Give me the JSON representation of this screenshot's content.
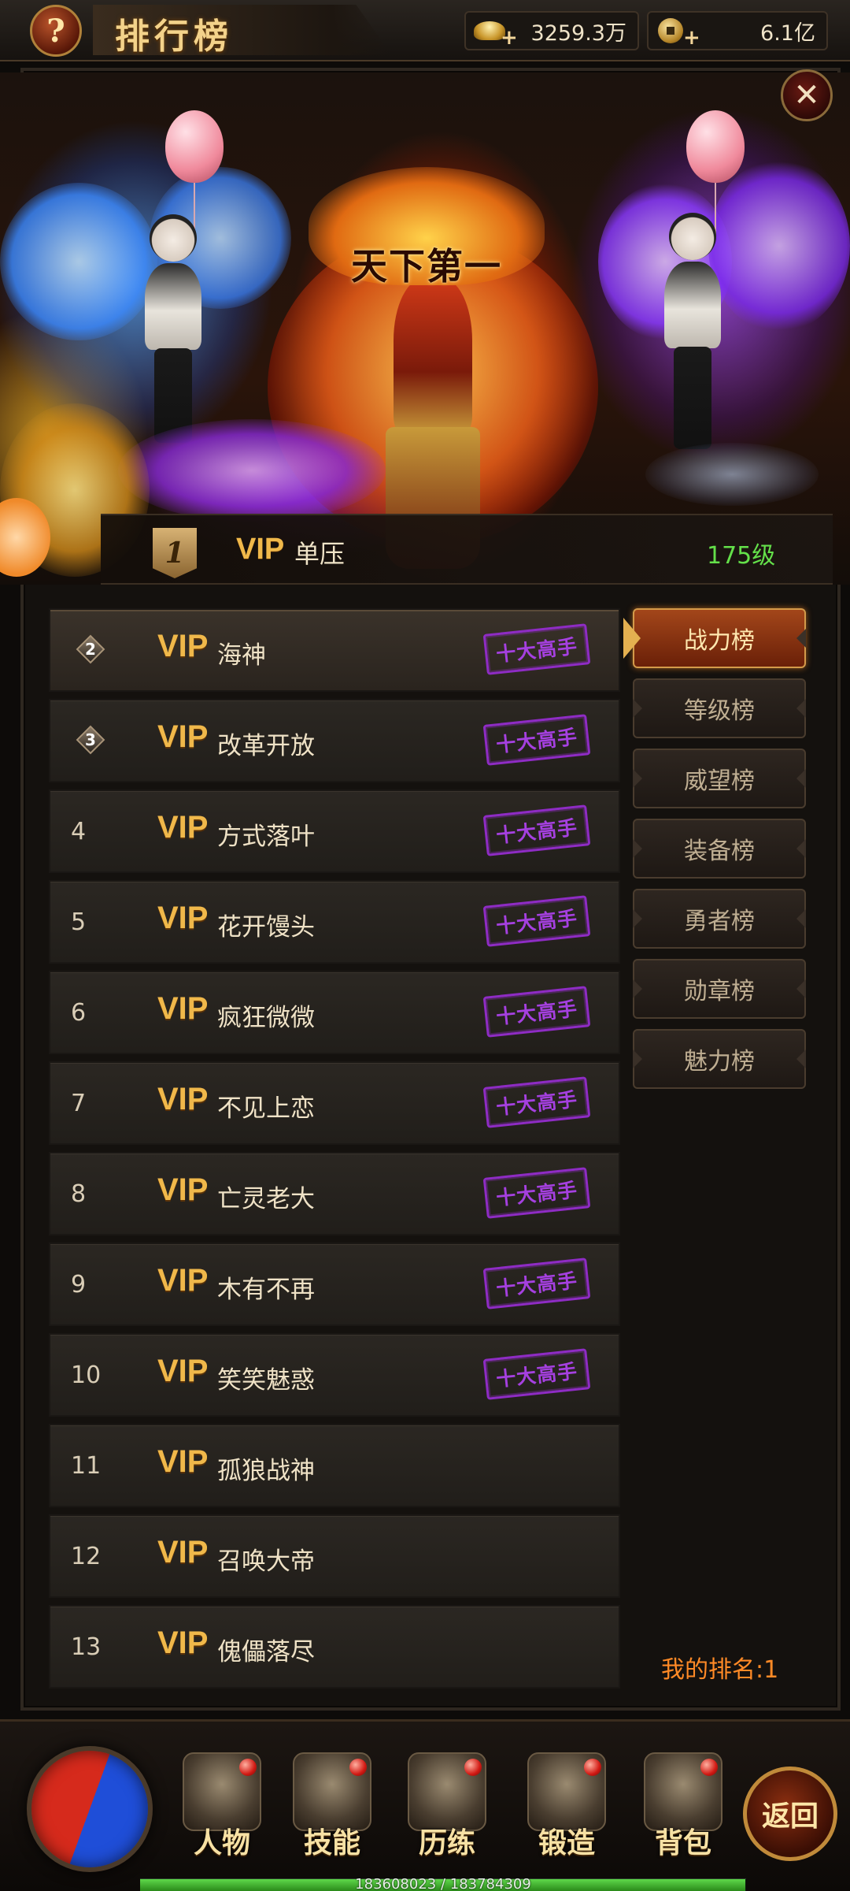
{
  "header": {
    "title": "排行榜",
    "help_icon": "question-icon",
    "gold": "3259.3万",
    "coins": "6.1亿"
  },
  "hero": {
    "banner_title": "天下第一",
    "close_icon": "close-icon",
    "top_player": {
      "rank": "1",
      "vip": "VIP",
      "name": "单压",
      "level": "175级"
    }
  },
  "rankings": [
    {
      "rank": "2",
      "vip": "VIP",
      "name": "海神",
      "badge": "十大高手",
      "medal": true
    },
    {
      "rank": "3",
      "vip": "VIP",
      "name": "改革开放",
      "badge": "十大高手",
      "medal": true
    },
    {
      "rank": "4",
      "vip": "VIP",
      "name": "方式落叶",
      "badge": "十大高手"
    },
    {
      "rank": "5",
      "vip": "VIP",
      "name": "花开馒头",
      "badge": "十大高手"
    },
    {
      "rank": "6",
      "vip": "VIP",
      "name": "疯狂微微",
      "badge": "十大高手"
    },
    {
      "rank": "7",
      "vip": "VIP",
      "name": "不见上恋",
      "badge": "十大高手"
    },
    {
      "rank": "8",
      "vip": "VIP",
      "name": "亡灵老大",
      "badge": "十大高手"
    },
    {
      "rank": "9",
      "vip": "VIP",
      "name": "木有不再",
      "badge": "十大高手"
    },
    {
      "rank": "10",
      "vip": "VIP",
      "name": "笑笑魅惑",
      "badge": "十大高手"
    },
    {
      "rank": "11",
      "vip": "VIP",
      "name": "孤狼战神",
      "badge": ""
    },
    {
      "rank": "12",
      "vip": "VIP",
      "name": "召唤大帝",
      "badge": ""
    },
    {
      "rank": "13",
      "vip": "VIP",
      "name": "傀儡落尽",
      "badge": ""
    }
  ],
  "tabs": [
    {
      "label": "战力榜",
      "active": true
    },
    {
      "label": "等级榜"
    },
    {
      "label": "威望榜"
    },
    {
      "label": "装备榜"
    },
    {
      "label": "勇者榜"
    },
    {
      "label": "勋章榜"
    },
    {
      "label": "魅力榜"
    }
  ],
  "my_rank": "我的排名:1",
  "bottom_nav": {
    "items": [
      {
        "label": "人物"
      },
      {
        "label": "技能"
      },
      {
        "label": "历练"
      },
      {
        "label": "锻造"
      },
      {
        "label": "背包"
      }
    ],
    "back": "返回"
  },
  "exp": {
    "text": "183608023 / 183784309",
    "fraction": 0.999
  },
  "colors": {
    "vip_gold": "#f0b84a",
    "level_green": "#64e04a",
    "my_rank_orange": "#ff8a26",
    "stamp_purple": "#a540e0"
  }
}
